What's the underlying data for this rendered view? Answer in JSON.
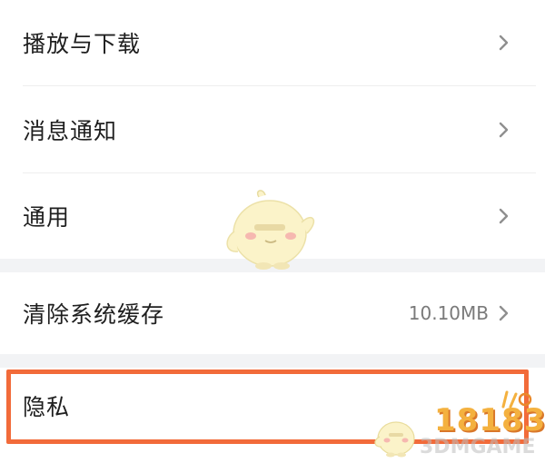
{
  "settings": {
    "items": [
      {
        "label": "播放与下载",
        "icon": "chevron-right-icon"
      },
      {
        "label": "消息通知",
        "icon": "chevron-right-icon"
      },
      {
        "label": "通用",
        "icon": "chevron-right-icon"
      },
      {
        "label": "清除系统缓存",
        "value": "10.10MB",
        "icon": "chevron-right-icon"
      },
      {
        "label": "隐私"
      }
    ]
  },
  "highlight": {
    "color": "#f26b3a"
  },
  "watermark": {
    "logo_text": "18183",
    "site_text": "3DMGAME"
  }
}
